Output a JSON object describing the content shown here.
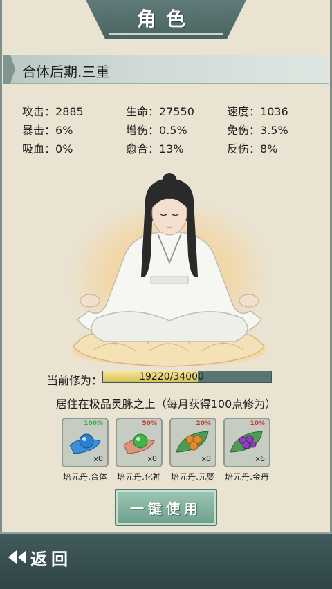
{
  "header": {
    "title": "角色"
  },
  "realm": {
    "text": "合体后期.三重"
  },
  "stats": [
    {
      "label": "攻击：",
      "value": "2885"
    },
    {
      "label": "生命：",
      "value": "27550"
    },
    {
      "label": "速度：",
      "value": "1036"
    },
    {
      "label": "暴击：",
      "value": "6%"
    },
    {
      "label": "增伤：",
      "value": "0.5%"
    },
    {
      "label": "免伤：",
      "value": "3.5%"
    },
    {
      "label": "吸血：",
      "value": "0%"
    },
    {
      "label": "愈合：",
      "value": "13%"
    },
    {
      "label": "反伤：",
      "value": "8%"
    }
  ],
  "cultivation": {
    "label": "当前修为：",
    "current": 19220,
    "max": 34000,
    "text": "19220/34000",
    "residence": "居住在极品灵脉之上（每月获得100点修为）"
  },
  "items": [
    {
      "name": "培元丹.合体",
      "pct": "100%",
      "qty": "x0",
      "pct_color": "#3aa845",
      "icon": "blue-pill-icon"
    },
    {
      "name": "培元丹.化神",
      "pct": "50%",
      "qty": "x0",
      "pct_color": "#c0392b",
      "icon": "green-pill-icon"
    },
    {
      "name": "培元丹.元婴",
      "pct": "20%",
      "qty": "x0",
      "pct_color": "#c0392b",
      "icon": "orange-pills-icon"
    },
    {
      "name": "培元丹.金丹",
      "pct": "10%",
      "qty": "x6",
      "pct_color": "#c0392b",
      "icon": "purple-pills-icon"
    }
  ],
  "actions": {
    "use_all": "一键使用",
    "back": "返回"
  }
}
